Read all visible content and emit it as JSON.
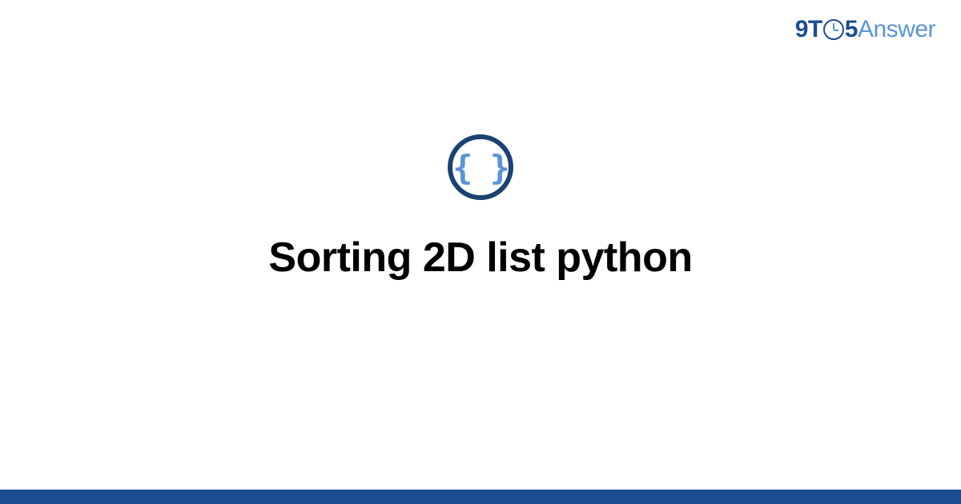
{
  "logo": {
    "part1": "9T",
    "part2": "5",
    "part3": "Answer"
  },
  "icon": {
    "braces": "{ }"
  },
  "title": "Sorting 2D list python"
}
